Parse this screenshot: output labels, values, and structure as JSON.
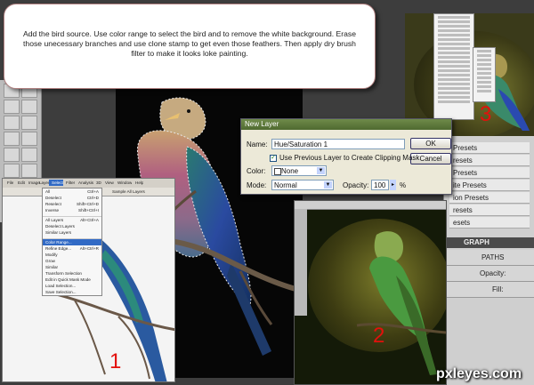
{
  "instruction": "Add the bird source. Use color range to select the bird and to remove the white background. Erase those unecessary branches and use clone stamp to get even those feathers. Then apply dry brush filter to make it looks loke painting.",
  "dialog": {
    "title": "New Layer",
    "name_label": "Name:",
    "name_value": "Hue/Saturation 1",
    "ok_label": "OK",
    "cancel_label": "Cancel",
    "clipping_label": "Use Previous Layer to Create Clipping Mask",
    "clipping_checked": "✓",
    "color_label": "Color:",
    "color_value": "None",
    "mode_label": "Mode:",
    "mode_value": "Normal",
    "opacity_label": "Opacity:",
    "opacity_value": "100",
    "opacity_unit": "%"
  },
  "presets": [
    "Presets",
    "resets",
    "Presets",
    "ite Presets",
    "ion Presets",
    "resets",
    "esets"
  ],
  "layers_panel": {
    "header": "GRAPH",
    "tab": "PATHS",
    "opacity_label": "Opacity:",
    "fill_label": "Fill:"
  },
  "step_numbers": [
    "1",
    "2",
    "3"
  ],
  "shot1": {
    "menubar": [
      "File",
      "Edit",
      "Image",
      "Layer",
      "Select",
      "Filter",
      "Analysis",
      "3D",
      "View",
      "Window",
      "Help"
    ],
    "sample_all_layers": "Sample All Layers",
    "menu": [
      {
        "label": "All",
        "key": "Ctrl+A"
      },
      {
        "label": "Deselect",
        "key": "Ctrl+D"
      },
      {
        "label": "Reselect",
        "key": "Shift+Ctrl+D"
      },
      {
        "label": "Inverse",
        "key": "Shift+Ctrl+I"
      },
      {
        "label": "",
        "key": ""
      },
      {
        "label": "All Layers",
        "key": "Alt+Ctrl+A"
      },
      {
        "label": "Deselect Layers",
        "key": ""
      },
      {
        "label": "Similar Layers",
        "key": ""
      },
      {
        "label": "",
        "key": ""
      },
      {
        "label": "Color Range...",
        "key": ""
      },
      {
        "label": "Refine Edge...",
        "key": "Alt+Ctrl+R"
      },
      {
        "label": "Modify",
        "key": ""
      },
      {
        "label": "Grow",
        "key": ""
      },
      {
        "label": "Similar",
        "key": ""
      },
      {
        "label": "Transform Selection",
        "key": ""
      },
      {
        "label": "Edit in Quick Mask Mode",
        "key": ""
      },
      {
        "label": "Load Selection...",
        "key": ""
      },
      {
        "label": "Save Selection...",
        "key": ""
      }
    ]
  },
  "watermark": "pxleyes.com",
  "colors": {
    "step_red": "#e3100c",
    "dialog_title": "#5a7638",
    "dialog_bg": "#ece9d8"
  }
}
